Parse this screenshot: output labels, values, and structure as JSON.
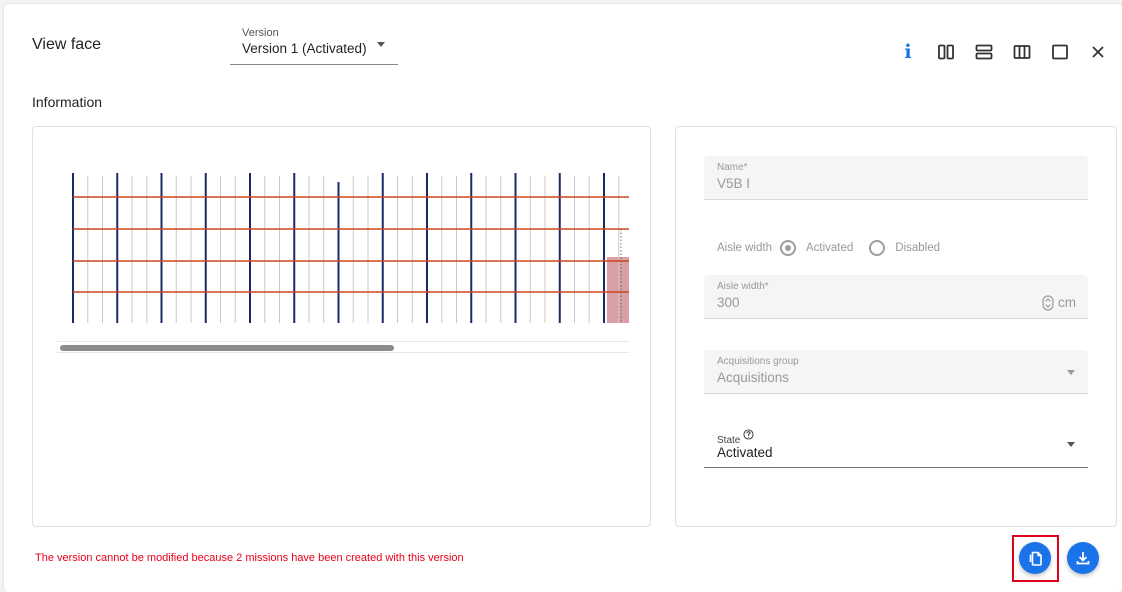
{
  "header": {
    "title": "View face",
    "version_label": "Version",
    "version_value": "Version 1 (Activated)"
  },
  "toolbar": {
    "info_glyph": "i",
    "icons": [
      "info-icon",
      "two-columns-icon",
      "two-rows-icon",
      "three-columns-icon",
      "single-panel-icon",
      "close-icon"
    ]
  },
  "section": {
    "title": "Information"
  },
  "form": {
    "name": {
      "label": "Name*",
      "value": "V5B I"
    },
    "aisle_width_toggle": {
      "label": "Aisle width",
      "options": [
        "Activated",
        "Disabled"
      ],
      "selected": "Activated"
    },
    "aisle_width": {
      "label": "Aisle width*",
      "value": "300",
      "unit": "cm"
    },
    "acquisitions_group": {
      "label": "Acquisitions group",
      "value": "Acquisitions"
    },
    "state": {
      "label": "State",
      "value": "Activated"
    }
  },
  "footer": {
    "warning": "The version cannot be modified because 2 missions have been created with this version"
  },
  "colors": {
    "accent": "#1a73e8",
    "warning": "#e8001c",
    "shelf_line": "#d0441e",
    "upright": "#1c2a66",
    "selected_cell": "#d9a0a3"
  }
}
